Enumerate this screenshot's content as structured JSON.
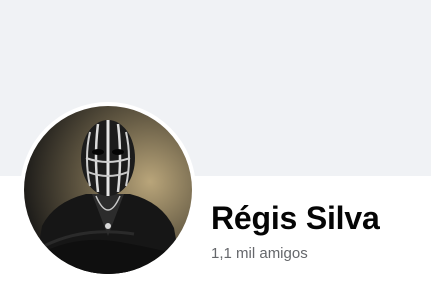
{
  "profile": {
    "name": "Régis Silva",
    "friends_count": "1,1 mil amigos"
  },
  "icons": {
    "avatar": "profile-photo-masked-man"
  },
  "colors": {
    "cover_background": "#f0f2f5",
    "name_text": "#050505",
    "secondary_text": "#65676b",
    "avatar_ring": "#ffffff"
  }
}
